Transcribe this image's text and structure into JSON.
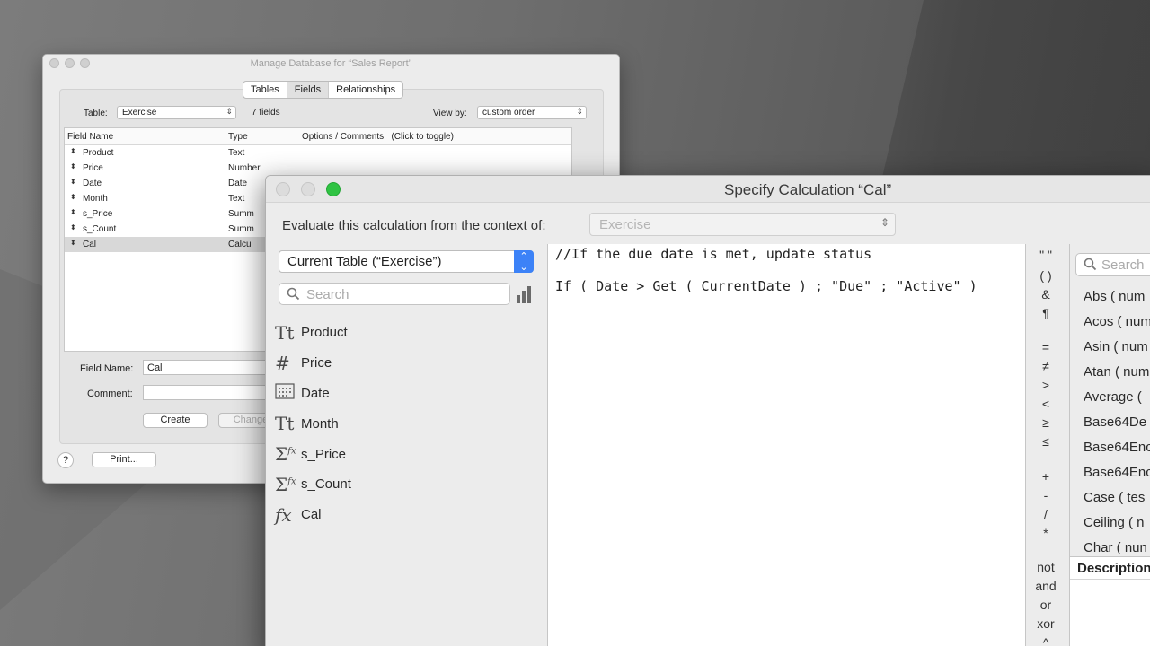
{
  "manage_db": {
    "title": "Manage Database for “Sales Report”",
    "tabs": [
      "Tables",
      "Fields",
      "Relationships"
    ],
    "active_tab": "Fields",
    "table_label": "Table:",
    "table_value": "Exercise",
    "field_count": "7 fields",
    "view_by_label": "View by:",
    "view_by_value": "custom order",
    "columns": [
      "Field Name",
      "Type",
      "Options / Comments   (Click to toggle)"
    ],
    "fields": [
      {
        "name": "Product",
        "type": "Text"
      },
      {
        "name": "Price",
        "type": "Number"
      },
      {
        "name": "Date",
        "type": "Date"
      },
      {
        "name": "Month",
        "type": "Text"
      },
      {
        "name": "s_Price",
        "type": "Summ"
      },
      {
        "name": "s_Count",
        "type": "Summ"
      },
      {
        "name": "Cal",
        "type": "Calcu"
      }
    ],
    "selected_field": "Cal",
    "field_name_label": "Field Name:",
    "field_name_value": "Cal",
    "comment_label": "Comment:",
    "create_label": "Create",
    "change_label": "Change",
    "help_label": "?",
    "print_label": "Print..."
  },
  "calc": {
    "title": "Specify Calculation “Cal”",
    "context_label": "Evaluate this calculation from the context of:",
    "context_value": "Exercise",
    "table_select": "Current Table (“Exercise”)",
    "search_placeholder": "Search",
    "fields": [
      {
        "icon": "text-field-icon",
        "glyph": "Tt",
        "name": "Product"
      },
      {
        "icon": "number-field-icon",
        "glyph": "#",
        "name": "Price"
      },
      {
        "icon": "date-field-icon",
        "glyph": "cal",
        "name": "Date"
      },
      {
        "icon": "text-field-icon",
        "glyph": "Tt",
        "name": "Month"
      },
      {
        "icon": "summary-field-icon",
        "glyph": "Σ",
        "name": "s_Price"
      },
      {
        "icon": "summary-field-icon",
        "glyph": "Σ",
        "name": "s_Count"
      },
      {
        "icon": "calculation-field-icon",
        "glyph": "fx",
        "name": "Cal"
      }
    ],
    "formula_lines": [
      "//If the due date is met, update status",
      "If ( Date > Get ( CurrentDate ) ; \"Due\" ; \"Active\" )"
    ],
    "operators": [
      "\" \"",
      "( )",
      "&",
      "¶",
      "=",
      "≠",
      ">",
      "<",
      "≥",
      "≤",
      "+",
      "-",
      "/",
      "*",
      "not",
      "and",
      "or",
      "xor",
      "^"
    ],
    "function_search_placeholder": "Search",
    "functions": [
      "Abs ( num",
      "Acos ( num",
      "Asin ( num",
      "Atan ( num",
      "Average (",
      "Base64De",
      "Base64Enc",
      "Base64Enc",
      "Case ( tes",
      "Ceiling ( n",
      "Char ( nun"
    ],
    "description_label": "Description"
  }
}
